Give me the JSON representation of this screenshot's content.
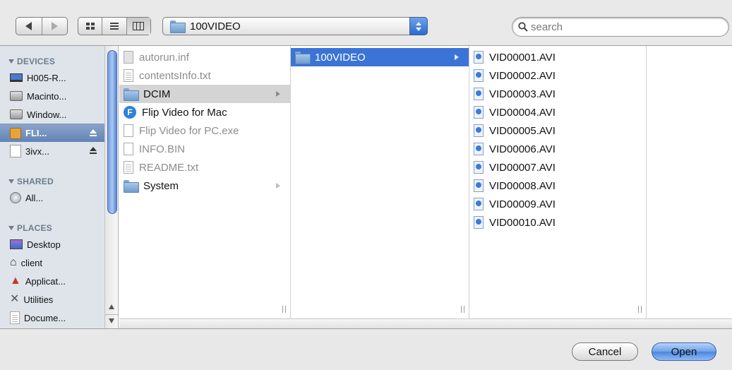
{
  "toolbar": {
    "path_label": "100VIDEO",
    "search_placeholder": "search"
  },
  "sidebar": {
    "devices_heading": "DEVICES",
    "devices": [
      {
        "label": "H005-R...",
        "icon": "laptop-icon"
      },
      {
        "label": "Macinto...",
        "icon": "hard-drive-icon"
      },
      {
        "label": "Window...",
        "icon": "hard-drive-icon"
      },
      {
        "label": "FLI...",
        "icon": "flip-drive-icon",
        "selected": true,
        "eject": true
      },
      {
        "label": "3ivx...",
        "icon": "blank-drive-icon",
        "eject": true
      }
    ],
    "shared_heading": "SHARED",
    "shared": [
      {
        "label": "All...",
        "icon": "network-icon"
      }
    ],
    "places_heading": "PLACES",
    "places": [
      {
        "label": "Desktop",
        "icon": "desktop-icon"
      },
      {
        "label": "client",
        "icon": "home-icon"
      },
      {
        "label": "Applicat...",
        "icon": "applications-icon"
      },
      {
        "label": "Utilities",
        "icon": "utilities-icon"
      },
      {
        "label": "Docume...",
        "icon": "documents-icon"
      }
    ]
  },
  "columns": {
    "col1": [
      {
        "label": "autorun.inf",
        "icon": "generic-file-icon",
        "dim": true
      },
      {
        "label": "contentsInfo.txt",
        "icon": "text-file-icon",
        "dim": true
      },
      {
        "label": "DCIM",
        "icon": "folder-icon",
        "dim": false,
        "folder": true,
        "selected": true
      },
      {
        "label": "Flip Video for Mac",
        "icon": "flip-app-icon",
        "dim": false
      },
      {
        "label": "Flip Video for PC.exe",
        "icon": "exe-file-icon",
        "dim": true
      },
      {
        "label": "INFO.BIN",
        "icon": "bin-file-icon",
        "dim": true
      },
      {
        "label": "README.txt",
        "icon": "text-file-icon",
        "dim": true
      },
      {
        "label": "System",
        "icon": "folder-icon",
        "dim": false,
        "folder": true
      }
    ],
    "col2": [
      {
        "label": "100VIDEO",
        "icon": "folder-icon",
        "folder": true,
        "selected": true
      }
    ],
    "col3": [
      {
        "label": "VID00001.AVI",
        "icon": "video-file-icon"
      },
      {
        "label": "VID00002.AVI",
        "icon": "video-file-icon"
      },
      {
        "label": "VID00003.AVI",
        "icon": "video-file-icon"
      },
      {
        "label": "VID00004.AVI",
        "icon": "video-file-icon"
      },
      {
        "label": "VID00005.AVI",
        "icon": "video-file-icon"
      },
      {
        "label": "VID00006.AVI",
        "icon": "video-file-icon"
      },
      {
        "label": "VID00007.AVI",
        "icon": "video-file-icon"
      },
      {
        "label": "VID00008.AVI",
        "icon": "video-file-icon"
      },
      {
        "label": "VID00009.AVI",
        "icon": "video-file-icon"
      },
      {
        "label": "VID00010.AVI",
        "icon": "video-file-icon"
      }
    ]
  },
  "buttons": {
    "cancel": "Cancel",
    "open": "Open"
  },
  "colors": {
    "selection": "#3b74d6",
    "sidebar_bg": "#dee4ea",
    "sidebar_selection": "#6384b7"
  }
}
